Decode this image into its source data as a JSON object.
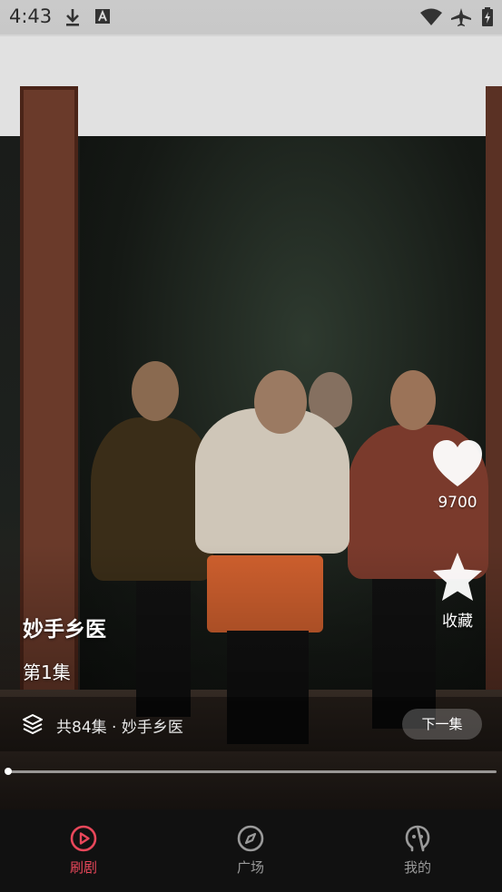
{
  "status_bar": {
    "time": "4:43"
  },
  "video": {
    "title": "妙手乡医",
    "episode": "第1集",
    "progress": 0.0
  },
  "actions": {
    "like_count": "9700",
    "favorite_label": "收藏"
  },
  "series": {
    "info": "共84集 · 妙手乡医",
    "next_label": "下一集"
  },
  "tabs": [
    {
      "label": "刷剧",
      "icon": "play-circle-icon",
      "active": true
    },
    {
      "label": "广场",
      "icon": "compass-icon",
      "active": false
    },
    {
      "label": "我的",
      "icon": "profile-icon",
      "active": false
    }
  ],
  "colors": {
    "accent": "#e8475a",
    "tab_inactive": "#9a9a9a"
  }
}
